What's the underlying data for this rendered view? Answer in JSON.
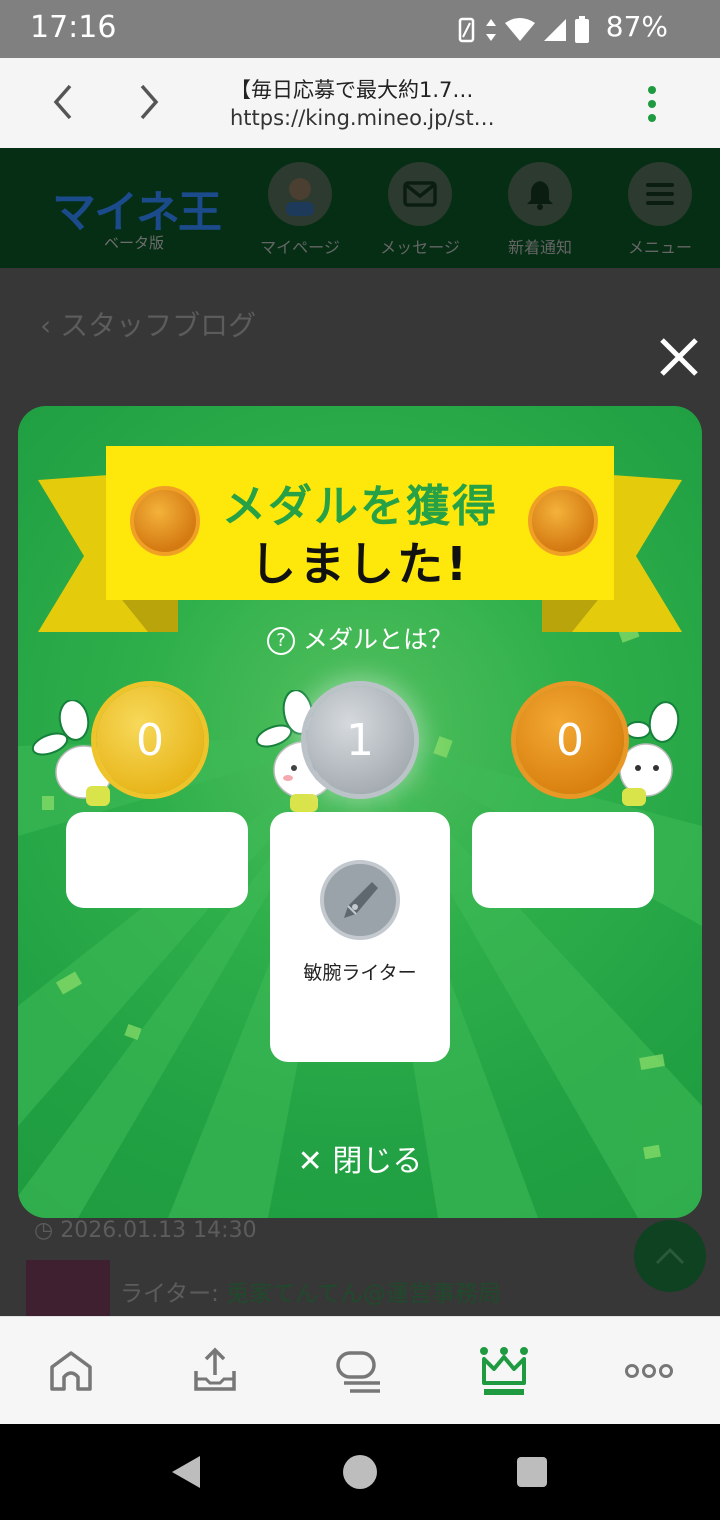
{
  "status_bar": {
    "time": "17:16",
    "battery": "87%"
  },
  "browser": {
    "title": "【毎日応募で最大約1.7…",
    "url": "https://king.mineo.jp/st…"
  },
  "site_header": {
    "logo": "マイネ王",
    "logo_sub": "ベータ版",
    "items": [
      {
        "label": "マイページ"
      },
      {
        "label": "メッセージ"
      },
      {
        "label": "新着通知"
      },
      {
        "label": "メニュー"
      }
    ]
  },
  "page": {
    "breadcrumb": "スタッフブログ",
    "date": "2026.01.13 14:30",
    "writer_prefix": "ライター: ",
    "writer_name": "兎家てんてん@運営事務局"
  },
  "modal": {
    "title_line1": "メダルを獲得",
    "title_line2": "しました!",
    "help_link": "メダルとは？",
    "medals": [
      {
        "kind": "gold",
        "count": "0"
      },
      {
        "kind": "silver",
        "count": "1"
      },
      {
        "kind": "bronze",
        "count": "0"
      }
    ],
    "badge_name": "敏腕ライター",
    "close_label": "閉じる"
  },
  "colors": {
    "modal_green": "#22a244",
    "ribbon_yellow": "#fee70b",
    "title_green": "#27a146",
    "nav_active": "#1f9a41"
  }
}
